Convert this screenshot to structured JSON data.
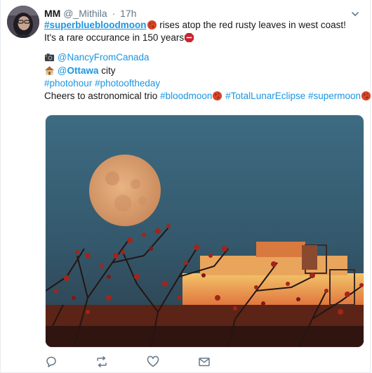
{
  "tweet": {
    "author_name": "MM",
    "author_handle": "@_Mithila",
    "separator": "·",
    "time": "17h",
    "text": {
      "l1_tag": "#superbluebloodmoon",
      "l1_rest": " rises atop the red rusty leaves in west coast!",
      "l2": "It's a rare occurance in 150 years",
      "l3_mention": "@NancyFromCanada",
      "l4_mention_at": "@",
      "l4_mention_bold": "Ottawa",
      "l4_rest": " city",
      "l5_tag1": "#photohour",
      "l5_space": " ",
      "l5_tag2": "#photooftheday",
      "l6_prefix": "Cheers to astronomical trio ",
      "l6_tag1": "#bloodmoon",
      "l6_tag2": "#TotalLunarEclipse",
      "l6_tag3": "#supermoon"
    },
    "icons": {
      "blood_moon_emoji": "full-moon-red-emoji",
      "stop_emoji": "octagon-emoji",
      "camera_emoji": "camera-emoji",
      "house_emoji": "house-emoji"
    },
    "actions": [
      "reply",
      "retweet",
      "like",
      "direct-message"
    ],
    "colors": {
      "link": "#1b95e0",
      "muted": "#657786",
      "action_icon": "#657786"
    }
  }
}
